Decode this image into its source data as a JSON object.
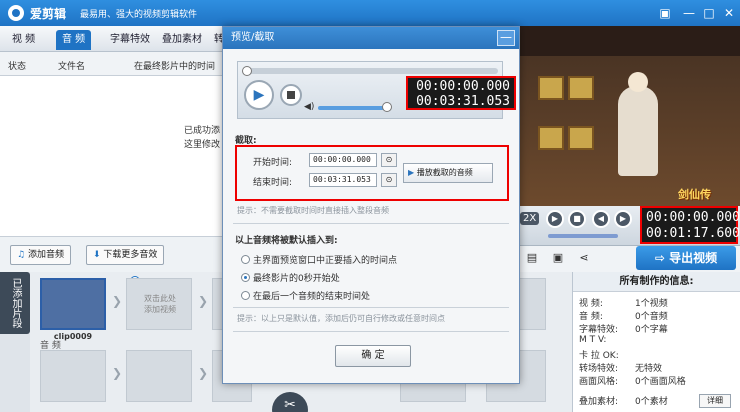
{
  "app": {
    "name": "爱剪辑",
    "slogan": "最易用、强大的视频剪辑软件"
  },
  "tabs": [
    "视 频",
    "音 频",
    "字幕特效",
    "叠加素材",
    "转"
  ],
  "audio_list": {
    "columns": [
      "状态",
      "文件名",
      "在最终影片中的时间"
    ],
    "message_line1": "已成功添",
    "message_line2": "这里修改"
  },
  "dialog": {
    "title": "预览/截取",
    "min_label": "—",
    "current_time": "00:00:00.000",
    "total_time": "00:03:31.053",
    "cut_section_label": "截取:",
    "start_label": "开始时间:",
    "start_value": "00:00:00.000",
    "end_label": "结束时间:",
    "end_value": "00:03:31.053",
    "play_cut_label": "播放截取的音频",
    "cut_hint": "提示：不需要截取时间时直接插入整段音频",
    "insert_label": "以上音频将被默认插入到:",
    "options": [
      {
        "label": "主界面预览窗口中正要插入的时间点",
        "selected": false
      },
      {
        "label": "最终影片的0秒开始处",
        "selected": true
      },
      {
        "label": "在最后一个音频的结束时间处",
        "selected": false
      }
    ],
    "options_hint": "提示：以上只是默认值，添加后仍可自行修改或任意时间点",
    "ok_label": "确 定"
  },
  "preview": {
    "overlay_text": "剑仙传"
  },
  "player": {
    "speed": "2X",
    "current_time": "00:00:00.000",
    "total_time": "00:01:17.600"
  },
  "export_label": "导出视频",
  "add_buttons": {
    "add_audio": "添加音频",
    "download": "下载更多音效"
  },
  "vertical_tab": "已添加片段",
  "timeline": {
    "first_clip_label": "clip0009",
    "placeholder_line1": "双击此处",
    "placeholder_line2": "添加视频",
    "audio_lane_label": "音 频"
  },
  "info": {
    "title": "所有制作的信息:",
    "rows": [
      {
        "key": "视    频:",
        "val": "1个视频"
      },
      {
        "key": "音    频:",
        "val": "0个音频"
      },
      {
        "key": "字幕特效:",
        "val": "0个字幕"
      },
      {
        "key": "M  T  V:",
        "val": ""
      },
      {
        "key": "卡 拉 OK:",
        "val": ""
      },
      {
        "key": "转场特效:",
        "val": "无特效"
      },
      {
        "key": "画面风格:",
        "val": "0个画面风格"
      },
      {
        "key": "叠加素材:",
        "val": "0个素材"
      }
    ],
    "detail_label": "详细"
  },
  "colors": {
    "accent": "#1f73c4",
    "highlight_box": "#e00000"
  }
}
